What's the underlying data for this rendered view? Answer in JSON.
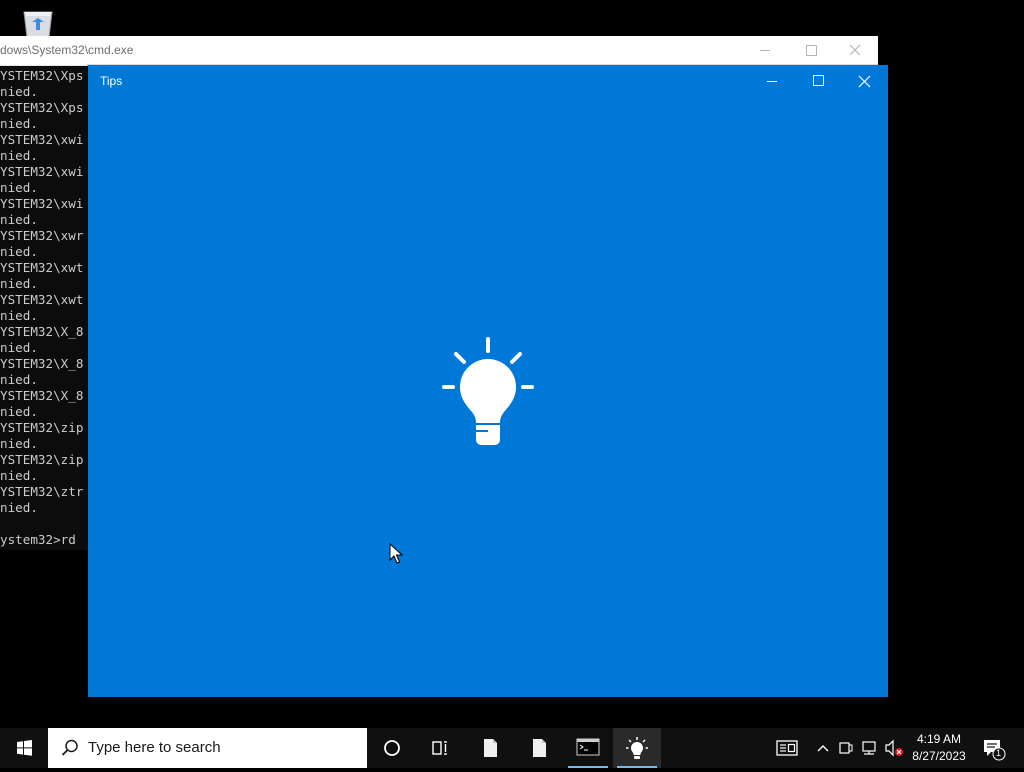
{
  "desktop": {
    "recycle_bin_icon": "recycle-bin-icon"
  },
  "cmd_window": {
    "title": "dows\\System32\\cmd.exe",
    "lines": [
      "YSTEM32\\Xps",
      "nied.",
      "YSTEM32\\Xps",
      "nied.",
      "YSTEM32\\xwi",
      "nied.",
      "YSTEM32\\xwi",
      "nied.",
      "YSTEM32\\xwi",
      "nied.",
      "YSTEM32\\xwr",
      "nied.",
      "YSTEM32\\xwt",
      "nied.",
      "YSTEM32\\xwt",
      "nied.",
      "YSTEM32\\X_8",
      "nied.",
      "YSTEM32\\X_8",
      "nied.",
      "YSTEM32\\X_8",
      "nied.",
      "YSTEM32\\zip",
      "nied.",
      "YSTEM32\\zip",
      "nied.",
      "YSTEM32\\ztr",
      "nied.",
      "",
      "ystem32>rd"
    ]
  },
  "tips_window": {
    "title": "Tips",
    "splash_icon": "lightbulb-icon",
    "background": "#0078d7"
  },
  "taskbar": {
    "search_placeholder": "Type here to search",
    "clock": {
      "time": "4:19 AM",
      "date": "8/27/2023"
    },
    "notification_count": "1",
    "accent_color": "#76b9ed"
  }
}
